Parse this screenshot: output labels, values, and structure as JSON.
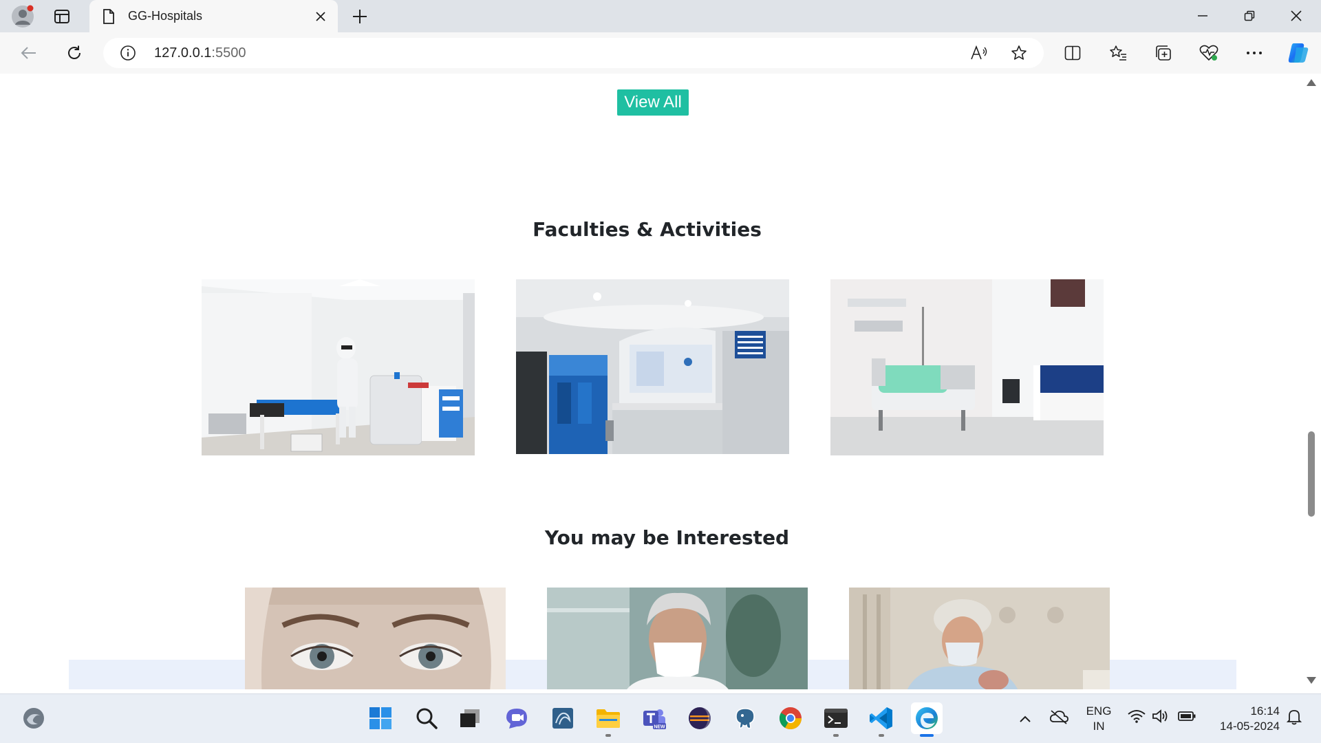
{
  "browser": {
    "tab_title": "GG-Hospitals",
    "url_host": "127.0.0.1",
    "url_port": ":5500"
  },
  "page": {
    "view_all_label": "View All",
    "faculties_title": "Faculties & Activities",
    "interested_title": "You may be Interested",
    "accent_color": "#1fbfa2"
  },
  "taskbar": {
    "lang_line1": "ENG",
    "lang_line2": "IN",
    "time": "16:14",
    "date": "14-05-2024"
  }
}
